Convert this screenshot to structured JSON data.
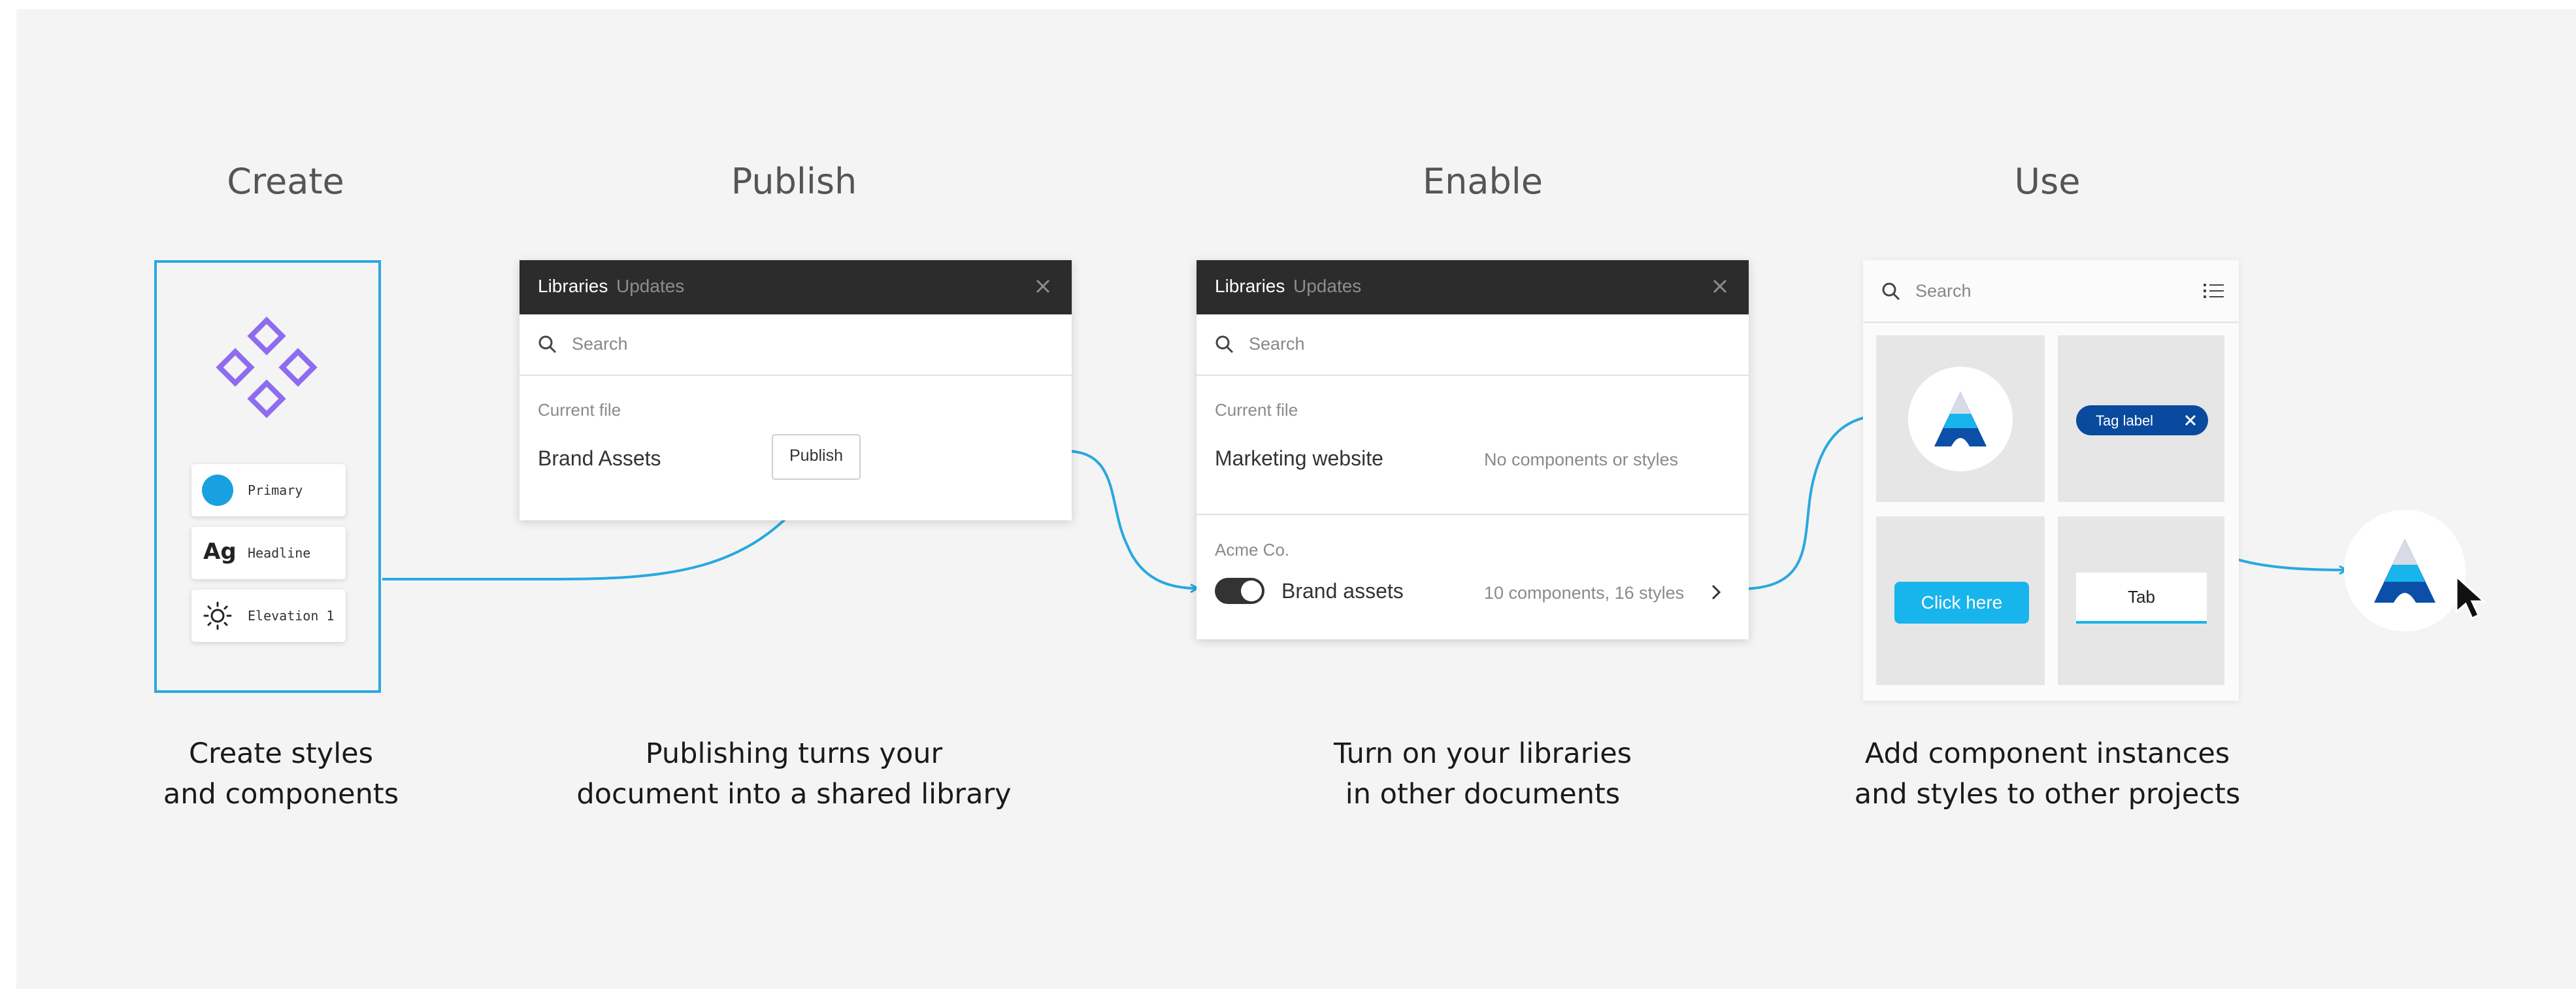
{
  "steps": [
    {
      "title": "Create",
      "caption_line1": "Create styles",
      "caption_line2": "and components"
    },
    {
      "title": "Publish",
      "caption_line1": "Publishing turns your",
      "caption_line2": "document into a shared library"
    },
    {
      "title": "Enable",
      "caption_line1": "Turn on your libraries",
      "caption_line2": "in other documents"
    },
    {
      "title": "Use",
      "caption_line1": "Add component instances",
      "caption_line2": "and styles to other projects"
    }
  ],
  "create": {
    "styles": [
      {
        "label": "Primary",
        "icon": "color-swatch-icon",
        "color": "#18a0e0"
      },
      {
        "label": "Headline",
        "icon": "ag-type-icon",
        "glyph": "Ag"
      },
      {
        "label": "Elevation 1",
        "icon": "sun-icon"
      }
    ],
    "component_color": "#8e6cf0",
    "frame_color": "#29a8e0"
  },
  "publish": {
    "tab_libraries": "Libraries",
    "tab_updates": "Updates",
    "search_placeholder": "Search",
    "section_label": "Current file",
    "file_name": "Brand Assets",
    "publish_button": "Publish"
  },
  "enable": {
    "tab_libraries": "Libraries",
    "tab_updates": "Updates",
    "search_placeholder": "Search",
    "section_current": "Current file",
    "current_name": "Marketing website",
    "current_status": "No components or styles",
    "section_team": "Acme  Co.",
    "library_name": "Brand assets",
    "library_counts": "10 components, 16 styles",
    "toggle_on": true
  },
  "use": {
    "search_placeholder": "Search",
    "tag_label": "Tag label",
    "click_button": "Click here",
    "tab_label": "Tab",
    "accent": "#18b4ec",
    "brand_dark": "#0b4fa8",
    "tag_color": "#0a4a9e"
  },
  "colors": {
    "connector": "#29a8e0",
    "panel_header": "#2c2c2c",
    "background": "#f4f4f4"
  }
}
